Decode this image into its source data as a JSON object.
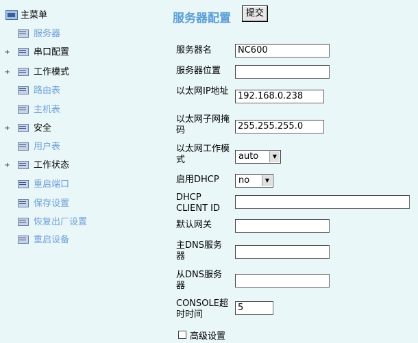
{
  "sidebar": {
    "root_label": "主菜单",
    "items": [
      {
        "label": "服务器",
        "expandable": false,
        "style": "link"
      },
      {
        "label": "串口配置",
        "expandable": true,
        "style": "dark"
      },
      {
        "label": "工作模式",
        "expandable": true,
        "style": "dark"
      },
      {
        "label": "路由表",
        "expandable": false,
        "style": "link"
      },
      {
        "label": "主机表",
        "expandable": false,
        "style": "link"
      },
      {
        "label": "安全",
        "expandable": true,
        "style": "dark"
      },
      {
        "label": "用户表",
        "expandable": false,
        "style": "link"
      },
      {
        "label": "工作状态",
        "expandable": true,
        "style": "dark"
      },
      {
        "label": "重启端口",
        "expandable": false,
        "style": "link"
      },
      {
        "label": "保存设置",
        "expandable": false,
        "style": "link"
      },
      {
        "label": "恢复出厂设置",
        "expandable": false,
        "style": "link"
      },
      {
        "label": "重启设备",
        "expandable": false,
        "style": "link"
      }
    ],
    "expand_glyph": "+"
  },
  "main": {
    "title": "服务器配置",
    "submit_label": "提交",
    "fields": {
      "server_name": {
        "label": "服务器名",
        "value": "NC600"
      },
      "server_location": {
        "label": "服务器位置",
        "value": ""
      },
      "ip_address": {
        "label": "以太网IP地址",
        "value": "192.168.0.238"
      },
      "subnet_mask": {
        "label": "以太网子网掩码",
        "value": "255.255.255.0"
      },
      "eth_mode": {
        "label": "以太网工作模式",
        "value": "auto"
      },
      "dhcp": {
        "label": "启用DHCP",
        "value": "no"
      },
      "dhcp_client_id": {
        "label": "DHCP CLIENT ID",
        "value": ""
      },
      "gateway": {
        "label": "默认网关",
        "value": ""
      },
      "primary_dns": {
        "label": "主DNS服务器",
        "value": ""
      },
      "secondary_dns": {
        "label": "从DNS服务器",
        "value": ""
      },
      "console_timeout": {
        "label": "CONSOLE超时时间",
        "value": "5"
      }
    },
    "advanced_label": "高级设置",
    "select_arrow_glyph": "▼"
  }
}
